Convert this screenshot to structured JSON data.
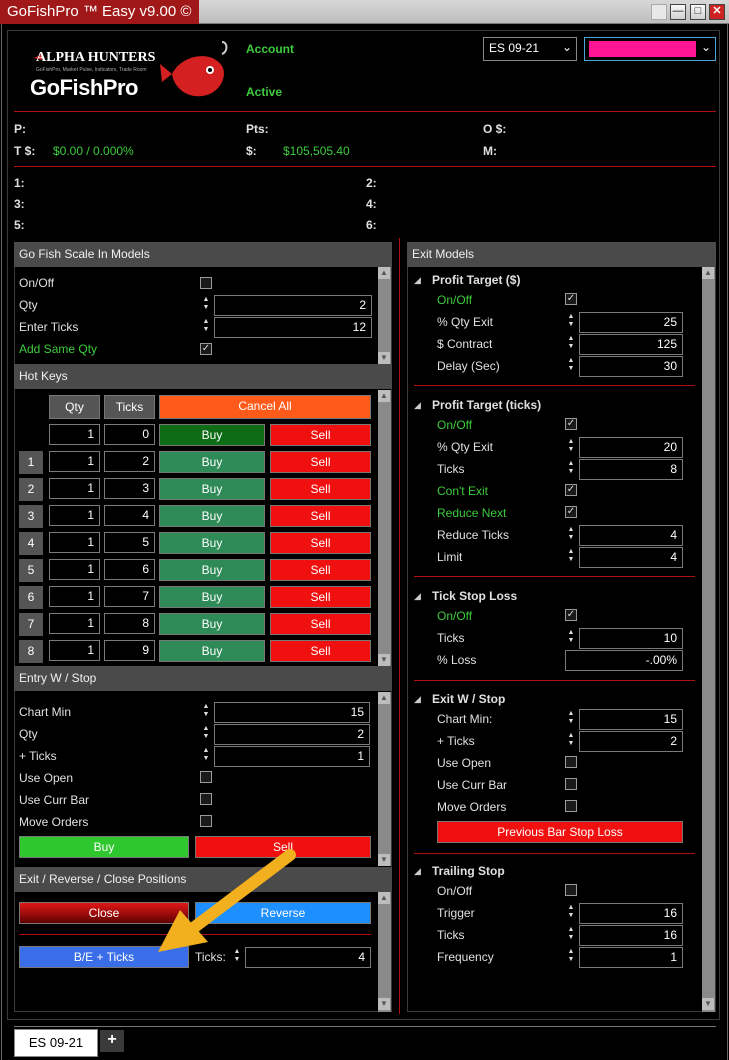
{
  "window": {
    "title": "GoFishPro ™ Easy v9.00 ©"
  },
  "logo": {
    "brand": "ALPHA HUNTERS",
    "tagline": "GoFishPro, Market Pulse, Indicators, Trade Room",
    "name": "GoFishPro"
  },
  "account": {
    "account_label": "Account",
    "status_label": "Active",
    "instrument": "ES 09-21",
    "color_swatch": "#ff1493"
  },
  "stats": {
    "p_label": "P:",
    "pts_label": "Pts:",
    "o_label": "O $:",
    "t_label": "T $:",
    "t_value": "$0.00 / 0.000%",
    "cash_label": "$:",
    "cash_value": "$105,505.40",
    "m_label": "M:"
  },
  "slots": [
    "1:",
    "2:",
    "3:",
    "4:",
    "5:",
    "6:"
  ],
  "scale_in": {
    "title": "Go Fish Scale In Models",
    "onoff_label": "On/Off",
    "qty_label": "Qty",
    "qty_value": "2",
    "ticks_label": "Enter Ticks",
    "ticks_value": "12",
    "same_qty_label": "Add Same Qty"
  },
  "hotkeys": {
    "title": "Hot Keys",
    "qty_header": "Qty",
    "ticks_header": "Ticks",
    "cancel_all": "Cancel All",
    "buy_label": "Buy",
    "sell_label": "Sell",
    "rows": [
      {
        "idx": "",
        "qty": "1",
        "ticks": "0"
      },
      {
        "idx": "1",
        "qty": "1",
        "ticks": "2"
      },
      {
        "idx": "2",
        "qty": "1",
        "ticks": "3"
      },
      {
        "idx": "3",
        "qty": "1",
        "ticks": "4"
      },
      {
        "idx": "4",
        "qty": "1",
        "ticks": "5"
      },
      {
        "idx": "5",
        "qty": "1",
        "ticks": "6"
      },
      {
        "idx": "6",
        "qty": "1",
        "ticks": "7"
      },
      {
        "idx": "7",
        "qty": "1",
        "ticks": "8"
      },
      {
        "idx": "8",
        "qty": "1",
        "ticks": "9"
      }
    ]
  },
  "entry_stop": {
    "title": "Entry W / Stop",
    "chart_min_label": "Chart Min",
    "chart_min_value": "15",
    "qty_label": "Qty",
    "qty_value": "2",
    "ticks_label": "+ Ticks",
    "ticks_value": "1",
    "use_open_label": "Use Open",
    "use_curr_bar_label": "Use Curr Bar",
    "move_orders_label": "Move Orders",
    "buy_label": "Buy",
    "sell_label": "Sell"
  },
  "exit_reverse": {
    "title": "Exit / Reverse / Close Positions",
    "close_label": "Close",
    "reverse_label": "Reverse",
    "be_label": "B/E + Ticks",
    "ticks_label": "Ticks:",
    "ticks_value": "4"
  },
  "exit_models": {
    "title": "Exit Models",
    "profit_target_dollars": {
      "title": "Profit Target ($)",
      "onoff_label": "On/Off",
      "qty_exit_label": "% Qty Exit",
      "qty_exit_value": "25",
      "contract_label": "$ Contract",
      "contract_value": "125",
      "delay_label": "Delay (Sec)",
      "delay_value": "30"
    },
    "profit_target_ticks": {
      "title": "Profit Target (ticks)",
      "onoff_label": "On/Off",
      "qty_exit_label": "% Qty Exit",
      "qty_exit_value": "20",
      "ticks_label": "Ticks",
      "ticks_value": "8",
      "cont_exit_label": "Con't Exit",
      "reduce_next_label": "Reduce Next",
      "reduce_ticks_label": "Reduce Ticks",
      "reduce_ticks_value": "4",
      "limit_label": "Limit",
      "limit_value": "4"
    },
    "tick_stop_loss": {
      "title": "Tick Stop Loss",
      "onoff_label": "On/Off",
      "ticks_label": "Ticks",
      "ticks_value": "10",
      "loss_label": "% Loss",
      "loss_value": "-.00%"
    },
    "exit_stop": {
      "title": "Exit W / Stop",
      "chart_min_label": "Chart Min:",
      "chart_min_value": "15",
      "ticks_label": "+ Ticks",
      "ticks_value": "2",
      "use_open_label": "Use Open",
      "use_curr_bar_label": "Use Curr Bar",
      "move_orders_label": "Move Orders",
      "prev_bar_label": "Previous Bar Stop Loss"
    },
    "trailing_stop": {
      "title": "Trailing Stop",
      "onoff_label": "On/Off",
      "trigger_label": "Trigger",
      "trigger_value": "16",
      "ticks_label": "Ticks",
      "ticks_value": "16",
      "frequency_label": "Frequency",
      "frequency_value": "1"
    }
  },
  "tabs": {
    "active": "ES 09-21",
    "add": "+"
  }
}
